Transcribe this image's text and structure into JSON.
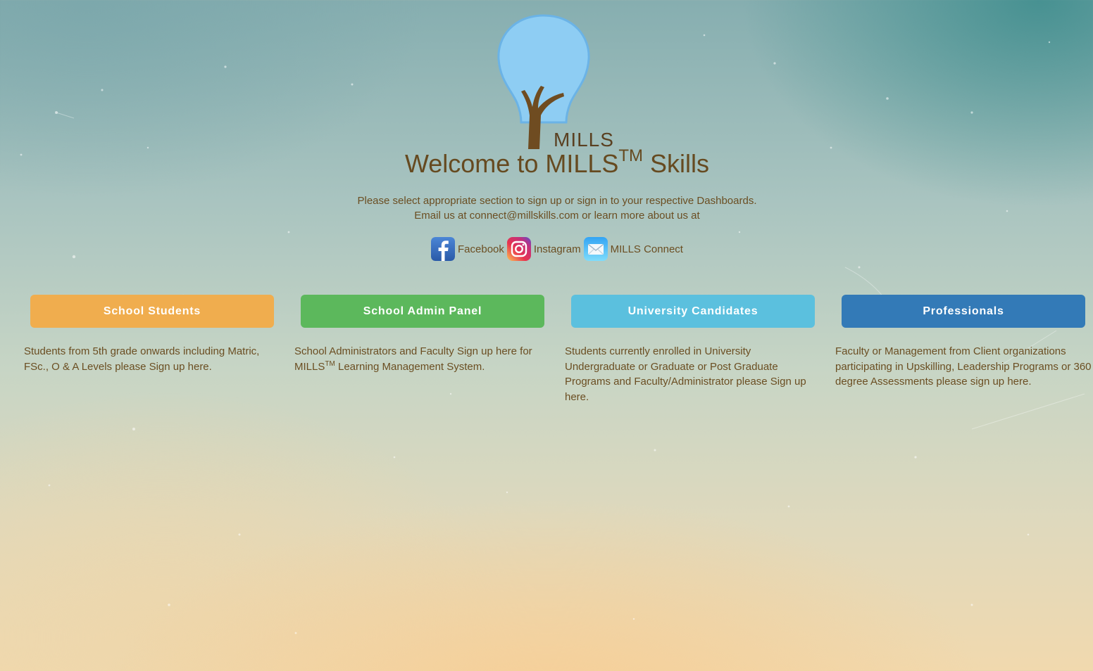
{
  "brand": {
    "logo_word": "MILLS",
    "colors": {
      "bulb": "#8ecdf3",
      "bulb_outline": "#6bb3e6",
      "trunk": "#6f4c21",
      "text": "#664a20"
    }
  },
  "header": {
    "welcome_prefix": "Welcome to MILLS",
    "welcome_tm": "TM",
    "welcome_suffix": " Skills",
    "intro_line1": "Please select appropriate section to sign up or sign in to your respective Dashboards.",
    "intro_line2": "Email us at connect@millskills.com or learn more about us at"
  },
  "social": [
    {
      "label": "Facebook",
      "icon": "facebook-icon"
    },
    {
      "label": "Instagram",
      "icon": "instagram-icon"
    },
    {
      "label": "MILLS Connect",
      "icon": "mail-icon"
    }
  ],
  "sections": [
    {
      "button": "School Students",
      "color": "#f0ad4e",
      "description": "Students from 5th grade onwards including Matric, FSc., O & A Levels please Sign up here."
    },
    {
      "button": "School Admin Panel",
      "color": "#5cb85c",
      "description_before": "School Administrators and Faculty Sign up here for MILLS",
      "description_tm": "TM",
      "description_after": " Learning Management System."
    },
    {
      "button": "University Candidates",
      "color": "#5bc0de",
      "description": "Students currently enrolled in University Undergraduate or Graduate or Post Graduate Programs and Faculty/Administrator please Sign up here."
    },
    {
      "button": "Professionals",
      "color": "#337ab7",
      "description": "Faculty or Management from Client organizations participating in Upskilling, Leadership Programs or 360 degree Assessments please sign up here."
    }
  ]
}
